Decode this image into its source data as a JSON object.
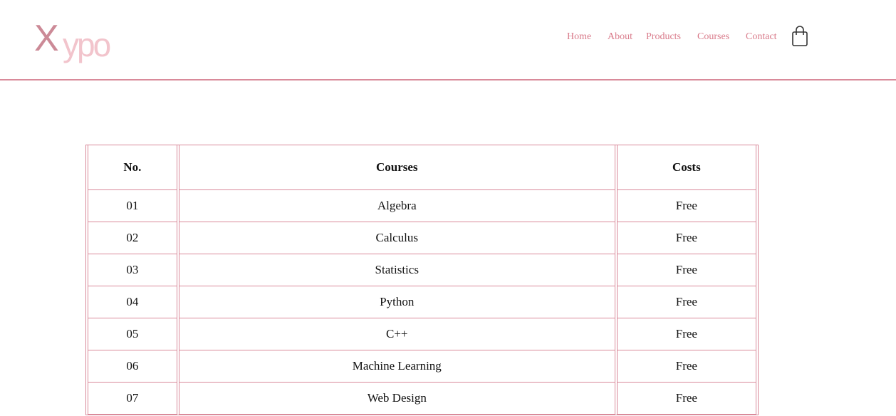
{
  "brand": {
    "logo_first": "X",
    "logo_rest": "ypo"
  },
  "nav": {
    "items": [
      {
        "label": "Home"
      },
      {
        "label": "About"
      },
      {
        "label": "Products"
      },
      {
        "label": "Courses"
      },
      {
        "label": "Contact"
      }
    ],
    "cart_icon": "shopping-bag-icon"
  },
  "colors": {
    "accent": "#d98a9a",
    "nav_text": "#d97a8a",
    "logo_primary": "#cc8a97",
    "logo_secondary": "#f2c4cc"
  },
  "table": {
    "headers": [
      "No.",
      "Courses",
      "Costs"
    ],
    "rows": [
      [
        "01",
        "Algebra",
        "Free"
      ],
      [
        "02",
        "Calculus",
        "Free"
      ],
      [
        "03",
        "Statistics",
        "Free"
      ],
      [
        "04",
        "Python",
        "Free"
      ],
      [
        "05",
        "C++",
        "Free"
      ],
      [
        "06",
        "Machine Learning",
        "Free"
      ],
      [
        "07",
        "Web Design",
        "Free"
      ]
    ]
  }
}
